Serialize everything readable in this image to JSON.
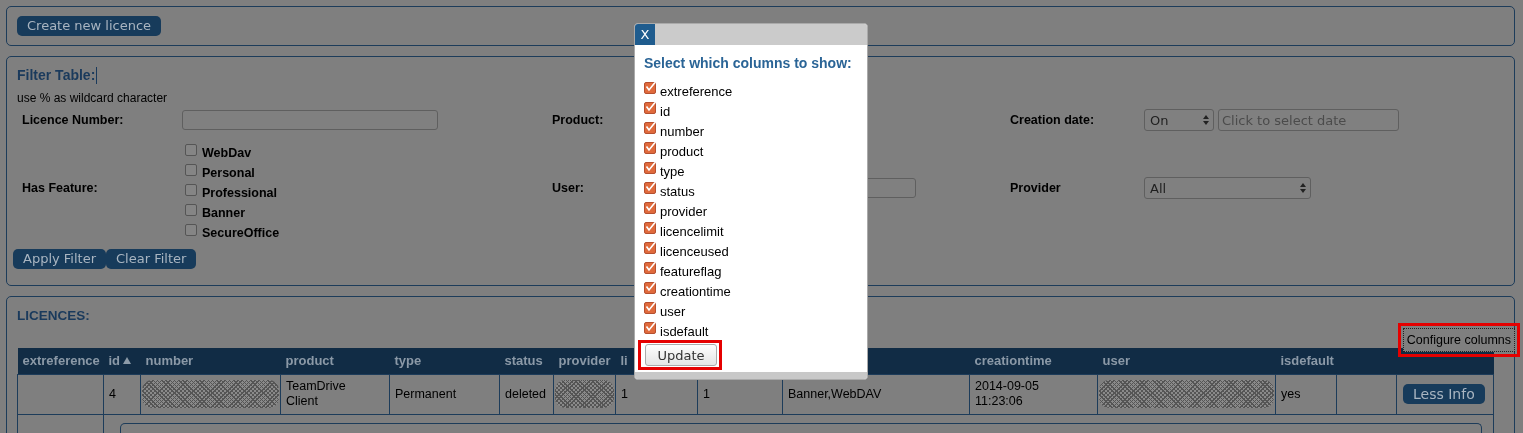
{
  "top_panel": {
    "button": "Create new licence"
  },
  "filter": {
    "title": "Filter Table:",
    "hint": "use % as wildcard character",
    "licence_number": {
      "label": "Licence Number:"
    },
    "product": {
      "label": "Product:"
    },
    "creation_date": {
      "label": "Creation date:",
      "mode": "On",
      "placeholder": "Click to select date"
    },
    "has_feature": {
      "label": "Has Feature:",
      "options": [
        {
          "label": "WebDav",
          "checked": false
        },
        {
          "label": "Personal",
          "checked": false
        },
        {
          "label": "Professional",
          "checked": false
        },
        {
          "label": "Banner",
          "checked": false
        },
        {
          "label": "SecureOffice",
          "checked": false
        }
      ]
    },
    "user": {
      "label": "User:"
    },
    "provider": {
      "label": "Provider",
      "value": "All"
    },
    "buttons": [
      "Apply Filter",
      "Clear Filter"
    ]
  },
  "licences": {
    "title": "LICENCES:",
    "configure_button": "Configure columns",
    "columns": [
      "extreference",
      "id",
      "number",
      "product",
      "type",
      "status",
      "provider",
      "li",
      "",
      "",
      "creationtime",
      "user",
      "isdefault",
      "",
      ""
    ],
    "rows": [
      {
        "cells": [
          {
            "kind": "blank"
          },
          {
            "kind": "text",
            "text": "4"
          },
          {
            "kind": "masked"
          },
          {
            "kind": "text",
            "text": "TeamDrive Client"
          },
          {
            "kind": "text",
            "text": "Permanent"
          },
          {
            "kind": "text",
            "text": "deleted"
          },
          {
            "kind": "masked"
          },
          {
            "kind": "text",
            "text": "1"
          },
          {
            "kind": "text",
            "text": "1"
          },
          {
            "kind": "text",
            "text": "Banner,WebDAV"
          },
          {
            "kind": "text",
            "text": "2014-09-05 11:23:06"
          },
          {
            "kind": "masked"
          },
          {
            "kind": "text",
            "text": "yes"
          },
          {
            "kind": "blank"
          },
          {
            "kind": "button",
            "text": "Less Info"
          }
        ]
      }
    ]
  },
  "dialog": {
    "close": "X",
    "title": "Select which columns to show:",
    "columns": [
      {
        "label": "extreference",
        "checked": true
      },
      {
        "label": "id",
        "checked": true
      },
      {
        "label": "number",
        "checked": true
      },
      {
        "label": "product",
        "checked": true
      },
      {
        "label": "type",
        "checked": true
      },
      {
        "label": "status",
        "checked": true
      },
      {
        "label": "provider",
        "checked": true
      },
      {
        "label": "licencelimit",
        "checked": true
      },
      {
        "label": "licenceused",
        "checked": true
      },
      {
        "label": "featureflag",
        "checked": true
      },
      {
        "label": "creationtime",
        "checked": true
      },
      {
        "label": "user",
        "checked": true
      },
      {
        "label": "isdefault",
        "checked": true
      }
    ],
    "button": "Update"
  }
}
